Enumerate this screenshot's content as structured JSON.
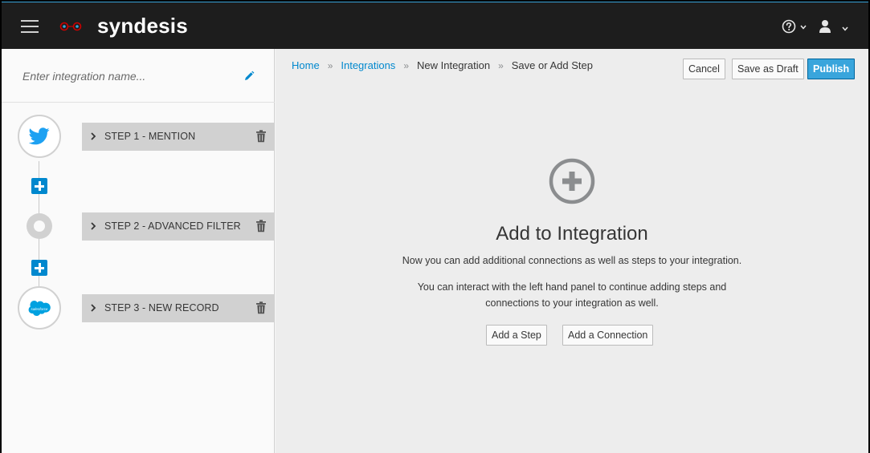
{
  "header": {
    "brand": "syndesis",
    "icons": {
      "menu": "hamburger-icon",
      "help": "help-icon",
      "user": "user-icon"
    },
    "accent": "#39a5dc"
  },
  "left_panel": {
    "name_placeholder": "Enter integration name...",
    "name_value": "",
    "steps": [
      {
        "label": "STEP 1 - MENTION",
        "icon": "twitter-icon"
      },
      {
        "label": "STEP 2 - ADVANCED FILTER",
        "icon": "filter-step-icon"
      },
      {
        "label": "STEP 3 - NEW RECORD",
        "icon": "salesforce-icon",
        "icon_text": "salesforce"
      }
    ]
  },
  "breadcrumb": {
    "home": "Home",
    "integrations": "Integrations",
    "new_integration": "New Integration",
    "current": "Save or Add Step"
  },
  "actions": {
    "cancel": "Cancel",
    "save_draft": "Save as Draft",
    "publish": "Publish"
  },
  "empty_state": {
    "title": "Add to Integration",
    "line1": "Now you can add additional connections as well as steps to your integration.",
    "line2": "You can interact with the left hand panel to continue adding steps and connections to your integration as well.",
    "add_step": "Add a Step",
    "add_connection": "Add a Connection"
  },
  "colors": {
    "primary": "#0088ce",
    "twitter": "#1da1f2",
    "salesforce": "#00a1e0"
  }
}
